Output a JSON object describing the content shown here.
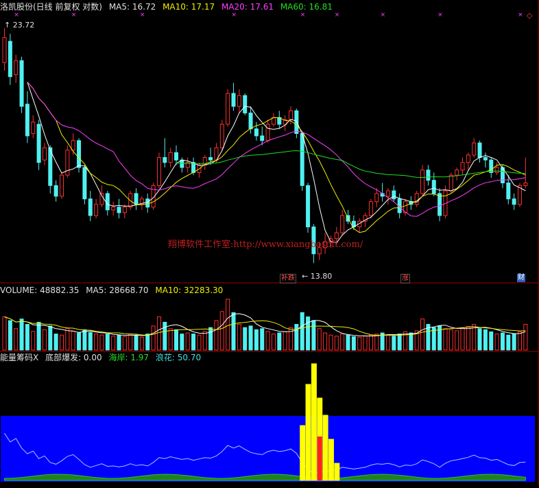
{
  "header": {
    "stock": "洛凯股份(日线 前复权 对数)",
    "ma5": "MA5: 16.72",
    "ma10": "MA10: 17.17",
    "ma20": "MA20: 17.61",
    "ma60": "MA60: 16.81"
  },
  "price_panel": {
    "high_label": "23.72",
    "low_label": "13.80",
    "watermark": "翔博软件工作室:http://www.xiangbosoft.com/",
    "tags": [
      {
        "text": "补跌",
        "color": "#ff5050"
      },
      {
        "text": "涨",
        "color": "#ff5050"
      },
      {
        "text": "财",
        "color": "#ffffff"
      }
    ]
  },
  "volume_panel": {
    "volume": "VOLUME: 48882.35",
    "ma5": "MA5: 28668.70",
    "ma10": "MA10: 32283.30"
  },
  "indicator_panel": {
    "name": "能量筹码X",
    "bottom_burst": "底部爆发: 0.00",
    "coast": "海岸: 1.97",
    "wave": "浪花: 50.70"
  },
  "colors": {
    "up": "#ff3030",
    "down": "#50f0f0",
    "ma5": "#ffffff",
    "ma10": "#f0f000",
    "ma20": "#ff40ff",
    "ma60": "#20e020",
    "indicator_bg": "#0000ff",
    "grid": "#a00000"
  },
  "chart_data": {
    "type": "candlestick",
    "scale": "log",
    "candles": [
      [
        21.9,
        23.7,
        21.5,
        23.2
      ],
      [
        23.0,
        23.4,
        20.8,
        21.2
      ],
      [
        21.3,
        22.3,
        20.9,
        22.0
      ],
      [
        22.0,
        22.2,
        19.5,
        19.8
      ],
      [
        19.9,
        20.5,
        18.2,
        18.5
      ],
      [
        18.6,
        19.4,
        18.4,
        19.1
      ],
      [
        19.0,
        19.2,
        17.1,
        17.4
      ],
      [
        17.5,
        18.2,
        17.3,
        18.0
      ],
      [
        18.0,
        18.1,
        16.2,
        16.5
      ],
      [
        16.5,
        16.7,
        15.9,
        16.1
      ],
      [
        16.1,
        17.0,
        16.0,
        16.9
      ],
      [
        16.9,
        18.1,
        16.8,
        17.9
      ],
      [
        17.9,
        18.6,
        17.7,
        18.3
      ],
      [
        18.3,
        18.4,
        17.0,
        17.2
      ],
      [
        17.2,
        17.3,
        15.8,
        16.0
      ],
      [
        16.0,
        16.3,
        15.2,
        15.4
      ],
      [
        15.4,
        16.0,
        15.3,
        15.8
      ],
      [
        15.8,
        16.5,
        15.7,
        16.2
      ],
      [
        16.2,
        16.3,
        15.4,
        15.6
      ],
      [
        15.6,
        15.9,
        15.4,
        15.7
      ],
      [
        15.7,
        16.0,
        15.3,
        15.5
      ],
      [
        15.5,
        15.8,
        15.3,
        15.7
      ],
      [
        15.7,
        16.3,
        15.6,
        16.2
      ],
      [
        16.2,
        16.4,
        15.6,
        15.8
      ],
      [
        15.8,
        16.1,
        15.6,
        16.0
      ],
      [
        16.0,
        16.2,
        15.5,
        15.7
      ],
      [
        15.7,
        16.6,
        15.6,
        16.5
      ],
      [
        16.5,
        17.8,
        16.4,
        17.6
      ],
      [
        17.6,
        18.4,
        17.2,
        17.4
      ],
      [
        17.4,
        18.0,
        17.2,
        17.8
      ],
      [
        17.8,
        18.1,
        17.3,
        17.5
      ],
      [
        17.5,
        17.6,
        17.0,
        17.2
      ],
      [
        17.2,
        17.6,
        17.0,
        17.4
      ],
      [
        17.4,
        17.6,
        16.9,
        17.0
      ],
      [
        17.0,
        17.4,
        16.8,
        17.3
      ],
      [
        17.3,
        17.7,
        17.1,
        17.6
      ],
      [
        17.6,
        18.0,
        17.3,
        17.5
      ],
      [
        17.5,
        18.2,
        17.4,
        18.0
      ],
      [
        18.0,
        19.2,
        17.9,
        19.0
      ],
      [
        19.0,
        20.6,
        18.9,
        20.4
      ],
      [
        20.4,
        20.9,
        19.6,
        19.8
      ],
      [
        19.8,
        20.6,
        19.5,
        20.3
      ],
      [
        20.3,
        20.4,
        19.4,
        19.5
      ],
      [
        19.5,
        19.8,
        18.6,
        18.8
      ],
      [
        18.8,
        19.1,
        18.3,
        18.5
      ],
      [
        18.5,
        18.9,
        18.1,
        18.3
      ],
      [
        18.3,
        19.2,
        18.2,
        19.0
      ],
      [
        19.0,
        19.5,
        18.9,
        19.3
      ],
      [
        19.3,
        19.6,
        18.8,
        19.0
      ],
      [
        19.0,
        19.4,
        18.7,
        19.2
      ],
      [
        19.2,
        19.8,
        19.0,
        19.6
      ],
      [
        19.6,
        19.7,
        18.4,
        18.6
      ],
      [
        18.6,
        18.7,
        16.3,
        16.5
      ],
      [
        16.5,
        16.6,
        14.8,
        15.0
      ],
      [
        15.0,
        15.1,
        13.8,
        14.1
      ],
      [
        14.1,
        14.5,
        13.9,
        14.3
      ],
      [
        14.3,
        14.8,
        14.1,
        14.5
      ],
      [
        14.5,
        14.7,
        14.3,
        14.6
      ],
      [
        14.6,
        15.0,
        14.4,
        14.8
      ],
      [
        14.8,
        15.6,
        14.7,
        15.4
      ],
      [
        15.4,
        15.6,
        15.1,
        15.2
      ],
      [
        15.2,
        15.4,
        14.9,
        15.0
      ],
      [
        15.0,
        15.3,
        14.8,
        15.2
      ],
      [
        15.2,
        15.5,
        15.0,
        15.4
      ],
      [
        15.4,
        16.0,
        15.3,
        15.9
      ],
      [
        15.9,
        16.4,
        15.7,
        16.2
      ],
      [
        16.2,
        16.6,
        15.9,
        16.1
      ],
      [
        16.1,
        16.4,
        15.8,
        16.3
      ],
      [
        16.3,
        16.5,
        15.9,
        16.0
      ],
      [
        16.0,
        16.2,
        15.3,
        15.5
      ],
      [
        15.5,
        16.0,
        15.4,
        15.9
      ],
      [
        15.9,
        16.1,
        15.6,
        15.8
      ],
      [
        15.8,
        16.3,
        15.7,
        16.2
      ],
      [
        16.2,
        17.3,
        16.1,
        17.1
      ],
      [
        17.1,
        17.3,
        16.5,
        16.7
      ],
      [
        16.7,
        17.0,
        16.1,
        16.2
      ],
      [
        16.2,
        16.4,
        15.2,
        15.4
      ],
      [
        15.4,
        16.5,
        15.3,
        16.3
      ],
      [
        16.3,
        17.0,
        16.2,
        16.9
      ],
      [
        16.9,
        17.2,
        16.7,
        17.1
      ],
      [
        17.1,
        17.6,
        16.9,
        17.4
      ],
      [
        17.4,
        17.8,
        17.1,
        17.7
      ],
      [
        17.7,
        18.4,
        17.6,
        18.2
      ],
      [
        18.2,
        18.3,
        17.4,
        17.6
      ],
      [
        17.6,
        17.8,
        17.2,
        17.5
      ],
      [
        17.5,
        17.6,
        16.8,
        17.0
      ],
      [
        17.0,
        17.4,
        16.9,
        17.2
      ],
      [
        17.2,
        17.3,
        16.4,
        16.6
      ],
      [
        16.6,
        16.9,
        15.8,
        16.0
      ],
      [
        16.0,
        16.2,
        15.6,
        15.8
      ],
      [
        15.8,
        16.6,
        15.7,
        16.5
      ],
      [
        16.5,
        17.6,
        16.4,
        16.6
      ]
    ],
    "volume": [
      62,
      55,
      40,
      58,
      48,
      35,
      52,
      38,
      45,
      30,
      28,
      40,
      35,
      32,
      38,
      33,
      30,
      28,
      30,
      26,
      28,
      25,
      30,
      28,
      24,
      30,
      45,
      62,
      52,
      40,
      38,
      30,
      32,
      30,
      28,
      35,
      42,
      55,
      72,
      95,
      70,
      48,
      42,
      45,
      38,
      40,
      35,
      30,
      32,
      34,
      42,
      48,
      70,
      62,
      55,
      40,
      32,
      28,
      26,
      30,
      28,
      25,
      24,
      26,
      28,
      30,
      32,
      28,
      26,
      30,
      34,
      32,
      36,
      58,
      48,
      42,
      45,
      40,
      38,
      36,
      42,
      44,
      48,
      40,
      38,
      34,
      30,
      32,
      28,
      30,
      34,
      48
    ],
    "indicator": {
      "series": [
        {
          "name": "海岸",
          "values": [
            1.97
          ]
        },
        {
          "name": "浪花",
          "values": [
            50.7
          ]
        }
      ]
    }
  }
}
